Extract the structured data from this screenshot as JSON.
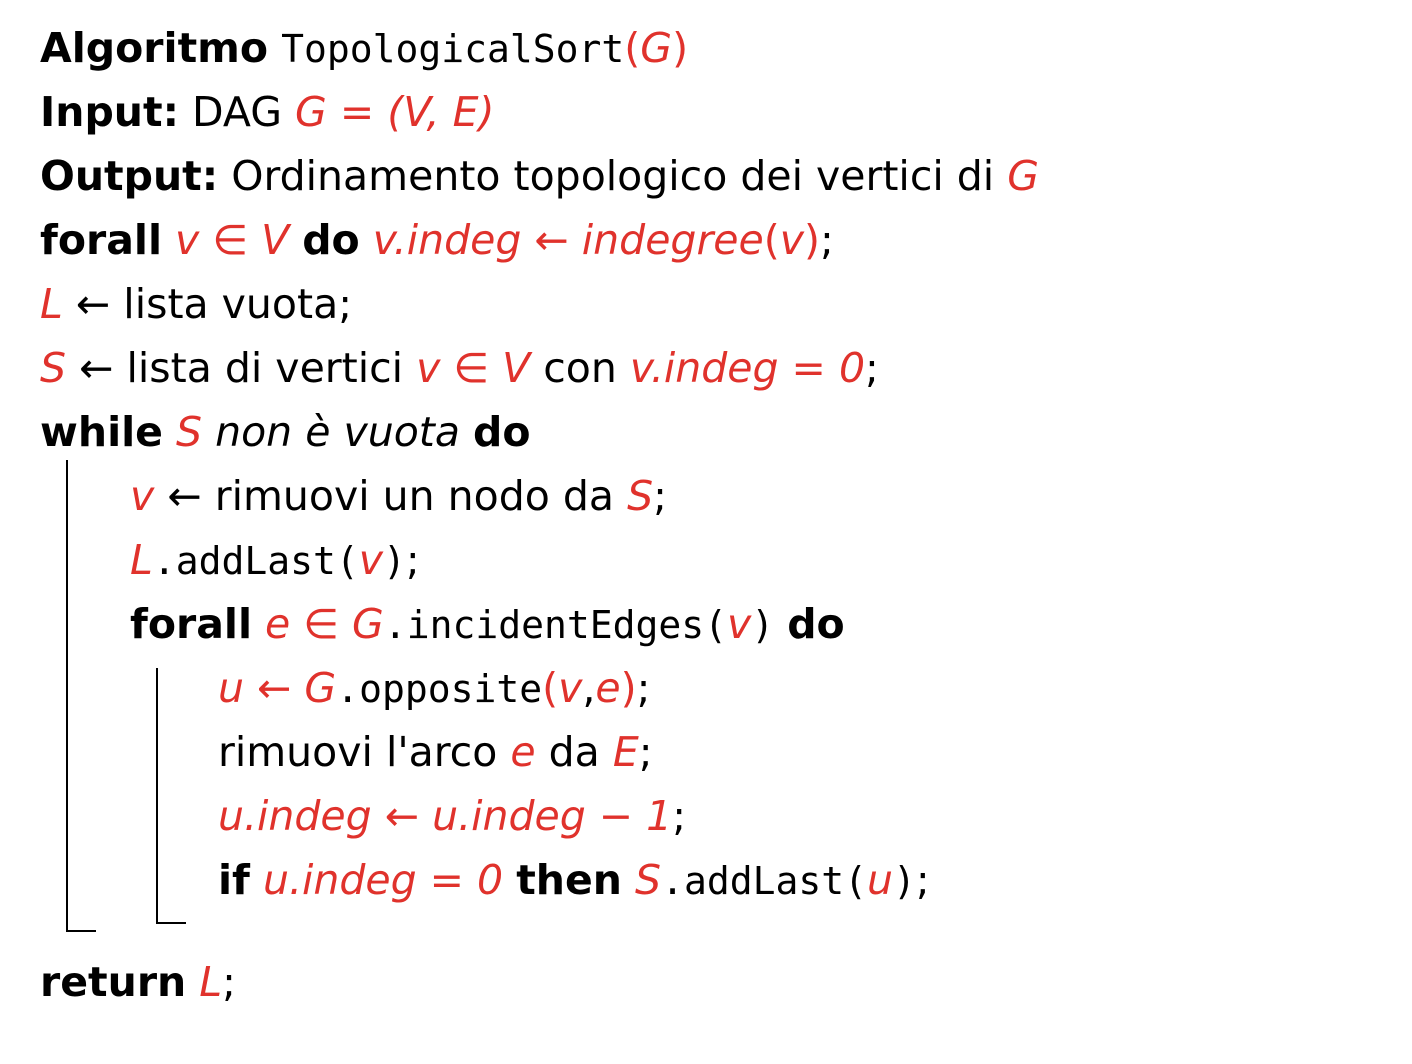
{
  "colors": {
    "accent": "#e0322c",
    "text": "#000000",
    "background": "#ffffff"
  },
  "header": {
    "algo_kw": "Algoritmo",
    "name": "TopologicalSort",
    "open": "(",
    "param": "G",
    "close": ")",
    "input_kw": "Input:",
    "input_text": "DAG",
    "input_math": "G = (V, E)",
    "output_kw": "Output:",
    "output_text": "Ordinamento topologico dei vertici di",
    "output_math": "G"
  },
  "l1": {
    "kw1": "forall",
    "m1": "v ∈ V",
    "kw2": "do",
    "m2": "v.indeg ← indegree",
    "p1": "(",
    "m3": "v",
    "p2": ")",
    "end": ";"
  },
  "l2": {
    "m1": "L",
    "arrow": "←",
    "text": "lista vuota;"
  },
  "l3": {
    "m1": "S",
    "arrow": "←",
    "text1": "lista di vertici",
    "m2": "v ∈ V",
    "text2": "con",
    "m3": "v.indeg = 0",
    "end": ";"
  },
  "l4": {
    "kw1": "while",
    "m1": "S",
    "cond": "non è vuota",
    "kw2": "do"
  },
  "l5": {
    "m1": "v",
    "arrow": "←",
    "text": "rimuovi un nodo da",
    "m2": "S",
    "end": ";"
  },
  "l6": {
    "m1": "L",
    "code": ".addLast(",
    "m2": "v",
    "close": ")",
    "end": ";"
  },
  "l7": {
    "kw1": "forall",
    "m1": "e ∈ G",
    "code": ".incidentEdges(",
    "m2": "v",
    "close": ")",
    "kw2": "do"
  },
  "l8": {
    "m1": "u ← G",
    "code": ".opposite",
    "open": "(",
    "m2": "v",
    "comma": ",",
    "m3": "e",
    "close": ")",
    "end": ";"
  },
  "l9": {
    "text1": "rimuovi l'arco",
    "m1": "e",
    "text2": "da",
    "m2": "E",
    "end": ";"
  },
  "l10": {
    "m1": "u.indeg ← u.indeg − 1",
    "end": ";"
  },
  "l11": {
    "kw1": "if",
    "m1": "u.indeg = 0",
    "kw2": "then",
    "m2": "S",
    "code": ".addLast(",
    "m3": "u",
    "close": ")",
    "end": ";"
  },
  "l12": {
    "kw": "return",
    "m1": "L",
    "end": ";"
  }
}
